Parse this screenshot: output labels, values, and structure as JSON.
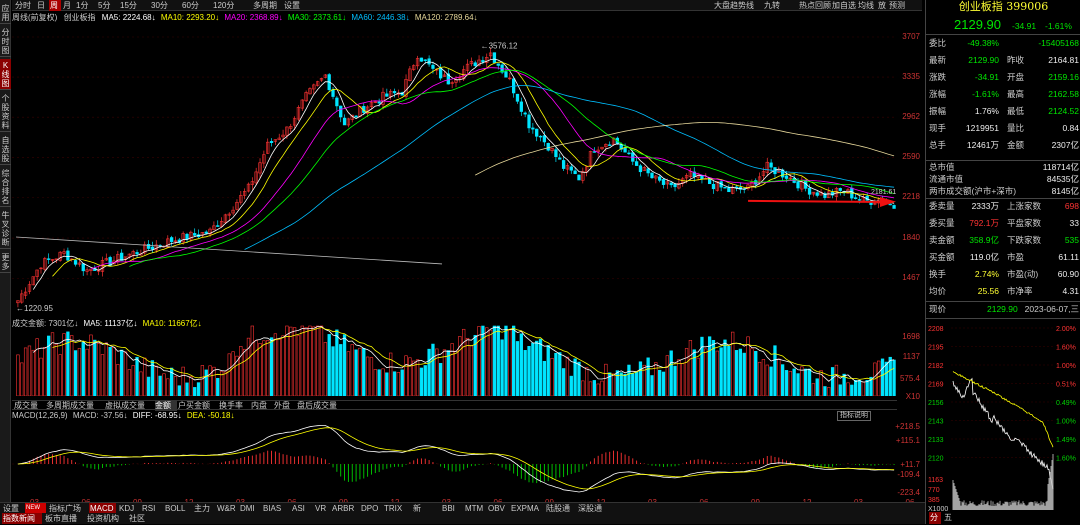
{
  "left_tabs": [
    "应用",
    "分时图",
    "K线图",
    "个股资料",
    "自选股",
    "综合排名",
    "牛叉诊断",
    "更多"
  ],
  "period_tabs": [
    "分时",
    "日",
    "周",
    "月",
    "1分",
    "5分",
    "15分",
    "30分",
    "60分",
    "120分",
    "多周期",
    "设置"
  ],
  "period_active": "周",
  "top_right": {
    "stock_ranking": "大盘趋势线",
    "nine": "九转",
    "hot_review": "热点回顾",
    "add": "加自选",
    "equal_line": "均线",
    "open": "放",
    "forecast": "预测"
  },
  "main_legend": {
    "name": "周线(前复权)",
    "security": "创业板指",
    "ma5": "MA5: 2224.68↓",
    "ma10": "MA10: 2293.20↓",
    "ma20": "MA20: 2368.89↓",
    "ma30": "MA30: 2373.61↓",
    "ma60": "MA60: 2446.38↓",
    "ma120": "MA120: 2789.64↓"
  },
  "k_yticks": [
    "3707",
    "3335",
    "2962",
    "2590",
    "2218",
    "1840",
    "1467"
  ],
  "k_annotations": {
    "high": "3576.12",
    "low": "1220.95",
    "last": "2181.61"
  },
  "volume_legend": {
    "total": "成交金额: 7301亿↓",
    "ma5": "MA5: 11137亿↓",
    "ma10": "MA10: 11667亿↓"
  },
  "vol_yticks": [
    "1698",
    "1137",
    "575.4",
    "X10"
  ],
  "sub_tabs": [
    "成交量",
    "多周期成交量",
    "虚拟成交量",
    "金额",
    "户买金额",
    "换手率",
    "内盘",
    "外盘",
    "盘后成交量"
  ],
  "sub_tab_active": "金额",
  "macd_legend": {
    "name": "MACD(12,26,9)",
    "macd": "MACD: -37.56↓",
    "diff": "DIFF: -68.95↓",
    "dea": "DEA: -50.18↓"
  },
  "macd_hint": "指标说明",
  "macd_yticks": [
    "+218.5",
    "+115.1",
    "+11.7",
    "-109.4",
    "-223.4"
  ],
  "x_ticks": [
    "03",
    "06",
    "09",
    "12",
    "03",
    "06",
    "09",
    "12",
    "03",
    "06",
    "09",
    "12",
    "03",
    "06",
    "09",
    "12",
    "03",
    "06"
  ],
  "bottom_tabs1": [
    "设置",
    "NEW",
    "指标广场",
    "MACD",
    "KDJ",
    "RSI",
    "BOLL",
    "主力",
    "W&R",
    "DMI",
    "BIAS",
    "ASI",
    "VR",
    "ARBR",
    "DPO",
    "TRIX",
    "新DMA",
    "BBI",
    "MTM",
    "OBV",
    "EXPMA",
    "陆股通",
    "深股通"
  ],
  "bottom_tab_active": "MACD",
  "bottom_tabs2": [
    "指数新闻",
    "板市直播",
    "投资机构",
    "社区"
  ],
  "quote": {
    "name": "创业板指",
    "code": "399006",
    "price": "2129.90",
    "change": "-34.91",
    "pct": "-1.61%",
    "rows": [
      {
        "l": "委比",
        "v": "-49.38%",
        "l2": "",
        "v2": "-15405168",
        "c": "green",
        "c2": "green"
      },
      {
        "l": "最新",
        "v": "2129.90",
        "l2": "昨收",
        "v2": "2164.81",
        "c": "green",
        "c2": "white"
      },
      {
        "l": "涨跌",
        "v": "-34.91",
        "l2": "开盘",
        "v2": "2159.16",
        "c": "green",
        "c2": "green"
      },
      {
        "l": "涨幅",
        "v": "-1.61%",
        "l2": "最高",
        "v2": "2162.58",
        "c": "green",
        "c2": "green"
      },
      {
        "l": "振幅",
        "v": "1.76%",
        "l2": "最低",
        "v2": "2124.52",
        "c": "white",
        "c2": "green"
      },
      {
        "l": "现手",
        "v": "1219951",
        "l2": "量比",
        "v2": "0.84",
        "c": "white",
        "c2": "white"
      },
      {
        "l": "总手",
        "v": "12461万",
        "l2": "金额",
        "v2": "2307亿",
        "c": "white",
        "c2": "white"
      }
    ],
    "cap": [
      {
        "l": "总市值",
        "v": "118714亿"
      },
      {
        "l": "流通市值",
        "v": "84535亿"
      },
      {
        "l": "两市成交额(沪市+深市)",
        "v": "8145亿"
      }
    ],
    "flow": [
      {
        "l": "委卖量",
        "v": "2333万",
        "l2": "上涨家数",
        "v2": "698",
        "c": "white",
        "c2": "red"
      },
      {
        "l": "委买量",
        "v": "792.1万",
        "l2": "平盘家数",
        "v2": "33",
        "c": "red",
        "c2": "white"
      },
      {
        "l": "卖金额",
        "v": "358.9亿",
        "l2": "下跌家数",
        "v2": "535",
        "c": "green",
        "c2": "green"
      },
      {
        "l": "买金额",
        "v": "119.0亿",
        "l2": "市盈",
        "v2": "61.11",
        "c": "white",
        "c2": "white"
      },
      {
        "l": "换手",
        "v": "2.74%",
        "l2": "市盈(动)",
        "v2": "60.90",
        "c": "yellow",
        "c2": "white"
      },
      {
        "l": "均价",
        "v": "25.56",
        "l2": "市净率",
        "v2": "4.31",
        "c": "yellow",
        "c2": "white"
      }
    ],
    "current": {
      "l": "现价",
      "v": "2129.90",
      "date": "2023-06-07,三"
    }
  },
  "mini_left_ticks": [
    "2208",
    "2195",
    "2182",
    "2169",
    "2156",
    "2143",
    "2133",
    "2120"
  ],
  "mini_right_ticks": [
    "2.00%",
    "1.60%",
    "1.00%",
    "0.51%",
    "0.49%",
    "1.00%",
    "1.49%",
    "1.60%"
  ],
  "mini_vol_ticks": [
    "1163",
    "770",
    "385",
    "X1000"
  ],
  "mini_tabs": [
    "分",
    "五"
  ],
  "colors": {
    "up": "#ff3333",
    "down": "#00e5ff",
    "ma5": "#ffffff",
    "ma10": "#ffff00",
    "ma20": "#ff00ff",
    "ma30": "#00ff00",
    "ma60": "#00bfff",
    "ma120": "#e6d79a"
  }
}
